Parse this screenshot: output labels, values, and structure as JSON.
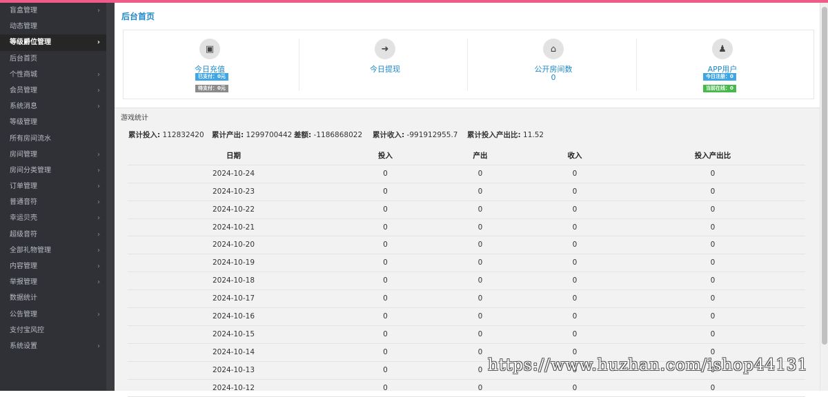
{
  "sidebar": {
    "items": [
      {
        "label": "盲盒管理",
        "arrow": "›"
      },
      {
        "label": "动态管理",
        "arrow": ""
      },
      {
        "label": "等级爵位管理",
        "arrow": "›"
      },
      {
        "label": "后台首页",
        "arrow": ""
      },
      {
        "label": "个性商城",
        "arrow": "›"
      },
      {
        "label": "会员管理",
        "arrow": "›"
      },
      {
        "label": "系统消息",
        "arrow": "›"
      },
      {
        "label": "等级管理",
        "arrow": ""
      },
      {
        "label": "所有房间流水",
        "arrow": ""
      },
      {
        "label": "房间管理",
        "arrow": "›"
      },
      {
        "label": "房间分类管理",
        "arrow": "›"
      },
      {
        "label": "订单管理",
        "arrow": "›"
      },
      {
        "label": "普通音符",
        "arrow": "›"
      },
      {
        "label": "幸运贝壳",
        "arrow": "›"
      },
      {
        "label": "超级音符",
        "arrow": "›"
      },
      {
        "label": "全部礼物管理",
        "arrow": "›"
      },
      {
        "label": "内容管理",
        "arrow": "›"
      },
      {
        "label": "举报管理",
        "arrow": "›"
      },
      {
        "label": "数据统计",
        "arrow": ""
      },
      {
        "label": "公告管理",
        "arrow": "›"
      },
      {
        "label": "支付宝风控",
        "arrow": ""
      },
      {
        "label": "系统设置",
        "arrow": "›"
      }
    ]
  },
  "header": {
    "title": "后台首页"
  },
  "stats": {
    "recharge": {
      "icon": "money-icon",
      "label": "今日充值",
      "paid": "已支付：0元",
      "unpaid": "待支付：0元"
    },
    "withdraw": {
      "icon": "sign-out-icon",
      "label": "今日提现"
    },
    "rooms": {
      "icon": "home-icon",
      "label": "公开房间数",
      "value": "0"
    },
    "users": {
      "icon": "user-tie-icon",
      "label": "APP用户",
      "registered": "今日注册：0",
      "online": "当前在线：0"
    }
  },
  "game": {
    "section_title": "游戏统计",
    "total_in_label": "累计投入:",
    "total_in": "112832420",
    "total_out_label": "累计产出:",
    "total_out": "1299700442",
    "diff_label": "差额:",
    "diff": "-1186868022",
    "total_income_label": "累计收入:",
    "total_income": "-991912955.7",
    "ratio_label": "累计投入产出比:",
    "ratio": "11.52"
  },
  "table": {
    "headers": [
      "日期",
      "投入",
      "产出",
      "收入",
      "投入产出比"
    ],
    "rows": [
      [
        "2024-10-24",
        "0",
        "0",
        "0",
        "0"
      ],
      [
        "2024-10-23",
        "0",
        "0",
        "0",
        "0"
      ],
      [
        "2024-10-22",
        "0",
        "0",
        "0",
        "0"
      ],
      [
        "2024-10-21",
        "0",
        "0",
        "0",
        "0"
      ],
      [
        "2024-10-20",
        "0",
        "0",
        "0",
        "0"
      ],
      [
        "2024-10-19",
        "0",
        "0",
        "0",
        "0"
      ],
      [
        "2024-10-18",
        "0",
        "0",
        "0",
        "0"
      ],
      [
        "2024-10-17",
        "0",
        "0",
        "0",
        "0"
      ],
      [
        "2024-10-16",
        "0",
        "0",
        "0",
        "0"
      ],
      [
        "2024-10-15",
        "0",
        "0",
        "0",
        "0"
      ],
      [
        "2024-10-14",
        "0",
        "0",
        "0",
        "0"
      ],
      [
        "2024-10-13",
        "0",
        "0",
        "0",
        "0"
      ],
      [
        "2024-10-12",
        "0",
        "0",
        "0",
        "0"
      ]
    ]
  },
  "watermark": "https://www.huzhan.com/ishop44131",
  "colors": {
    "accent": "#1e88c8",
    "topbar": "#ef5c8a",
    "sidebar": "#2f3136"
  }
}
